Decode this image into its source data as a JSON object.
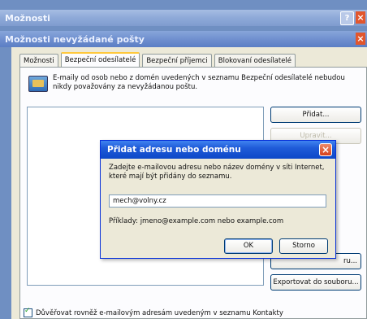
{
  "outer_window": {
    "title": "Možnosti",
    "help": "?",
    "close": "×"
  },
  "inner_window": {
    "title": "Možnosti nevyžádané pošty",
    "close": "×"
  },
  "tabs": [
    {
      "label": "Možnosti"
    },
    {
      "label": "Bezpeční odesílatelé"
    },
    {
      "label": "Bezpeční příjemci"
    },
    {
      "label": "Blokovaní odesílatelé"
    }
  ],
  "panel": {
    "info": "E-maily od osob nebo z domén uvedených v seznamu Bezpeční odesílatelé nebudou nikdy považovány za nevyžádanou poštu.",
    "buttons": {
      "add": "Přidat...",
      "edit": "Upravit...",
      "import_partial": "ru...",
      "export": "Exportovat do souboru..."
    },
    "checkbox_label": "Důvěřovat rovněž e-mailovým adresám uvedeným v seznamu Kontakty"
  },
  "popup": {
    "title": "Přidat adresu nebo doménu",
    "close": "×",
    "instruction": "Zadejte e-mailovou adresu nebo název domény v síti Internet, které mají být přidány do seznamu.",
    "input_value": "mech@volny.cz",
    "example": "Příklady: jmeno@example.com nebo example.com",
    "ok": "OK",
    "cancel": "Storno"
  }
}
